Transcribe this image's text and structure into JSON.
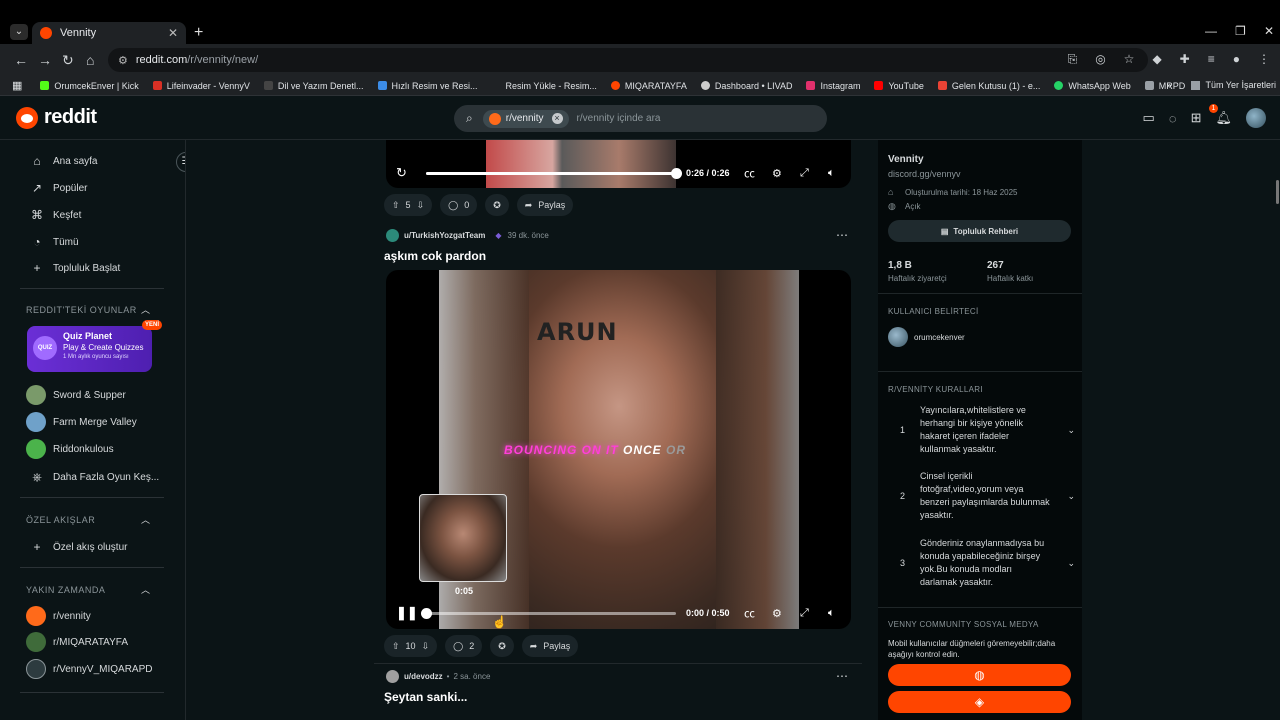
{
  "browser": {
    "tab_title": "Vennity",
    "url_host": "reddit.com",
    "url_path": "/r/vennity/new/",
    "bookmarks": [
      {
        "label": "OrumcekEnver | Kick",
        "color": "#53fc18"
      },
      {
        "label": "Lifeinvader - VennyV",
        "color": "#d93025"
      },
      {
        "label": "Dil ve Yazım Denetl...",
        "color": "#444444"
      },
      {
        "label": "Hızlı Resim ve Resi...",
        "color": "#3c8ce7"
      },
      {
        "label": "Resim Yükle - Resim...",
        "color": "#1f2225"
      },
      {
        "label": "MIQARATAYFA",
        "color": "#ff4500"
      },
      {
        "label": "Dashboard • LIVAD",
        "color": "#cccccc"
      },
      {
        "label": "Instagram",
        "color": "#e1306c"
      },
      {
        "label": "YouTube",
        "color": "#ff0000"
      },
      {
        "label": "Gelen Kutusu (1) - e...",
        "color": "#ea4335"
      },
      {
        "label": "WhatsApp Web",
        "color": "#25d366"
      },
      {
        "label": "MRPD",
        "color": "#9aa0a6"
      }
    ],
    "all_bookmarks": "Tüm Yer İşaretleri"
  },
  "header": {
    "logo_text": "reddit",
    "search_chip": "r/vennity",
    "search_placeholder": "r/vennity içinde ara",
    "notif_count": "1"
  },
  "sidebar": {
    "nav": [
      "Ana sayfa",
      "Popüler",
      "Keşfet",
      "Tümü",
      "Topluluk Başlat"
    ],
    "games_title": "REDDIT'TEKİ OYUNLAR",
    "quiz": {
      "title": "Quiz Planet",
      "subtitle": "Play & Create Quizzes",
      "meta": "1 Mn aylık oyuncu sayısı",
      "badge": "YENİ",
      "icon_text": "QUIZ"
    },
    "games": [
      "Sword & Supper",
      "Farm Merge Valley",
      "Riddonkulous",
      "Daha Fazla Oyun Keş..."
    ],
    "feeds_title": "ÖZEL AKIŞLAR",
    "create_feed": "Özel akış oluştur",
    "recent_title": "YAKIN ZAMANDA",
    "recent": [
      "r/vennity",
      "r/MIQARATAYFA",
      "r/VennyV_MIQARAPD"
    ]
  },
  "feed": {
    "prev_post": {
      "time": "0:26 / 0:26",
      "progress": 1.0,
      "votes": "5",
      "comments": "0",
      "share": "Paylaş"
    },
    "post": {
      "user": "u/TurkishYozgatTeam",
      "time": "39 dk. önce",
      "title": "aşkım cok pardon",
      "face_text": "ARUN",
      "caption_pink": "BOUNCING ON IT",
      "caption_white": "ONCE",
      "caption_grey": "OR",
      "preview_time": "0:05",
      "video_time": "0:00 / 0:50",
      "progress": 0.0,
      "votes": "10",
      "comments": "2",
      "share": "Paylaş"
    },
    "next_post": {
      "user": "u/devodzz",
      "time": "2 sa. önce",
      "title": "Şeytan sanki..."
    }
  },
  "right": {
    "name": "Vennity",
    "link": "discord.gg/vennyv",
    "created": "Oluşturulma tarihi: 18 Haz 2025",
    "visibility": "Açık",
    "guide_button": "Topluluk Rehberi",
    "stats": [
      {
        "value": "1,8 B",
        "label": "Haftalık ziyaretçi"
      },
      {
        "value": "267",
        "label": "Haftalık katkı"
      }
    ],
    "flair_title": "KULLANICI BELİRTECİ",
    "flair_user": "orumcekenver",
    "rules_title": "R/VENNİTY KURALLARI",
    "rules": [
      {
        "num": "1",
        "text": "Yayıncılara,whitelistlere ve herhangi bir kişiye yönelik hakaret içeren ifadeler kullanmak yasaktır."
      },
      {
        "num": "2",
        "text": "Cinsel içerikli fotoğraf,video,yorum veya benzeri paylaşımlarda bulunmak yasaktır."
      },
      {
        "num": "3",
        "text": "Gönderiniz onaylanmadıysa bu konuda yapabileceğiniz birşey yok.Bu konuda modları darlamak yasaktır."
      }
    ],
    "social_title": "VENNY COMMUNİTY SOSYAL MEDYA",
    "social_desc": "Mobil kullanıcılar düğmeleri göremeyebilir;daha aşağıyı kontrol edin."
  },
  "colors": {
    "accent": "#ff4500",
    "bg": "#0b1416",
    "panel": "#04090a"
  }
}
